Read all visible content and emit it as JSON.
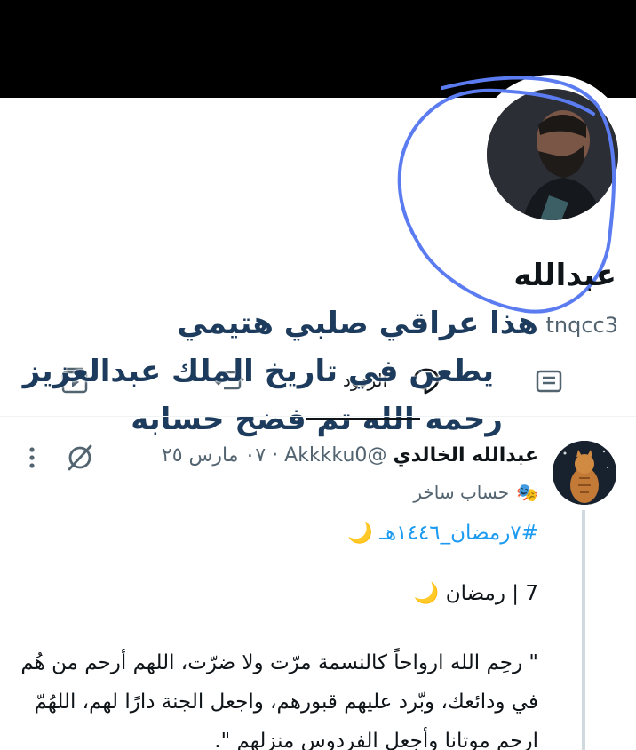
{
  "profile": {
    "display_name": "عبدالله",
    "handle": "tnqcc3"
  },
  "overlay_text": {
    "line1": "هذا عراقي صلبي هتيمي",
    "line2": "يطعن في تاريخ الملك عبدالعزيز",
    "line3": "رحمه الله تم فضح حسابه"
  },
  "tabs": {
    "replies_label": "الردود",
    "icons": [
      "media-icon",
      "retweet-icon",
      "reply-bubble-icon",
      "posts-icon"
    ]
  },
  "tweet": {
    "author_name": "عبدالله الخالدي",
    "author_handle": "@Akkkku0",
    "date": "٠٧ مارس ٢٥",
    "parody_label": "حساب ساخر",
    "hashtag": "#٧رمضان_١٤٤٦هـ",
    "day_line": "7 | رمضان",
    "body": "\" رحِم الله ارواحاً كالنسمة مرّت ولا ضرّت، اللهم أرحم من هُم في ودائعك، وبّرد عليهم قبورهم، واجعل الجنة دارًا لهم، اللهُمّ ارحم موتانا وأجعل الفردوس منزلهم \"."
  },
  "colors": {
    "header_bg": "#000000",
    "annotation_blue": "#5b7cf0",
    "overlay_text": "#1d3b5c",
    "hashtag": "#1d9bf0",
    "secondary_text": "#536471"
  }
}
